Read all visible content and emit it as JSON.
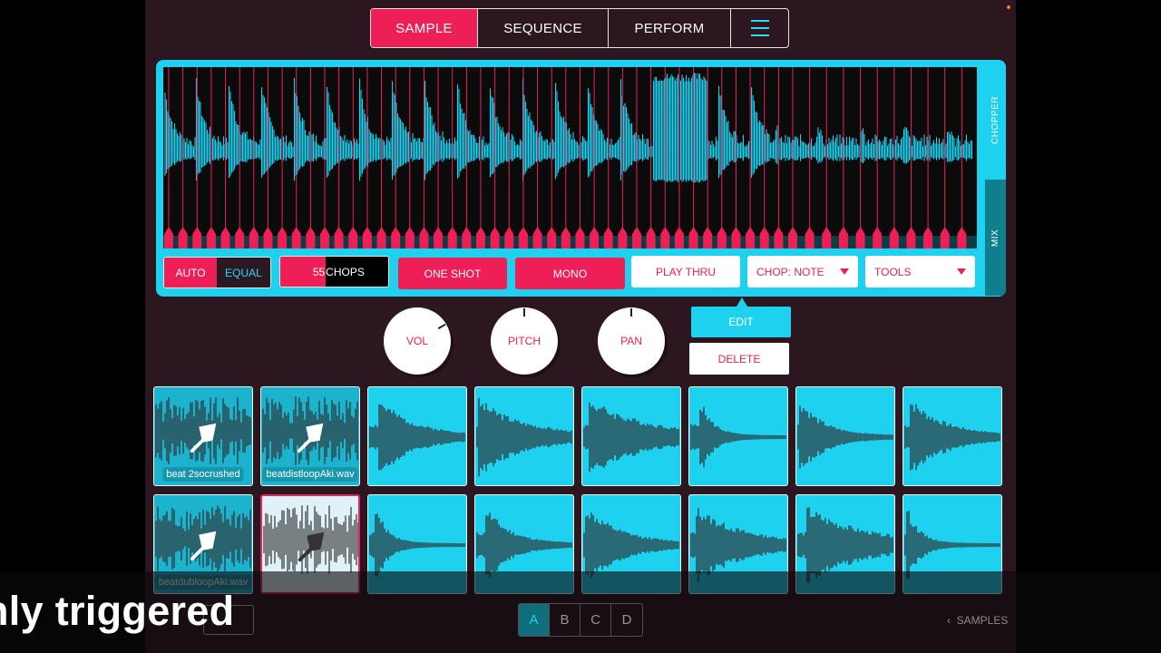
{
  "nav": {
    "tabs": [
      {
        "label": "SAMPLE",
        "active": true
      },
      {
        "label": "SEQUENCE",
        "active": false
      },
      {
        "label": "PERFORM",
        "active": false
      }
    ],
    "menu_icon": "hamburger-menu-icon"
  },
  "chopper": {
    "side_tabs": [
      "CHOPPER",
      "MIX"
    ],
    "mode": {
      "auto": "AUTO",
      "equal": "EQUAL",
      "active": "EQUAL"
    },
    "chops": {
      "count": "55",
      "label": "CHOPS"
    },
    "one_shot": "ONE SHOT",
    "mono": "MONO",
    "play_thru": "PLAY THRU",
    "chop_note": "CHOP: NOTE",
    "tools": "TOOLS"
  },
  "knobs": {
    "vol": {
      "label": "VOL",
      "level": 0.72
    },
    "pitch": {
      "label": "PITCH",
      "level": 0.5
    },
    "pan": {
      "label": "PAN",
      "level": 0.5
    }
  },
  "actions": {
    "edit": "EDIT",
    "delete": "DELETE"
  },
  "pads": [
    {
      "name": "beat 2socrushed",
      "chopped": true
    },
    {
      "name": "beatdistloopAki.wav",
      "chopped": true
    },
    {
      "name": "",
      "chopped": false
    },
    {
      "name": "",
      "chopped": false
    },
    {
      "name": "",
      "chopped": false
    },
    {
      "name": "",
      "chopped": false
    },
    {
      "name": "",
      "chopped": false
    },
    {
      "name": "",
      "chopped": false
    },
    {
      "name": "beatdubloopAki.wav",
      "chopped": true
    },
    {
      "name": "",
      "chopped": true,
      "selected": true
    },
    {
      "name": "",
      "chopped": false
    },
    {
      "name": "",
      "chopped": false
    },
    {
      "name": "",
      "chopped": false
    },
    {
      "name": "",
      "chopped": false
    },
    {
      "name": "",
      "chopped": false
    },
    {
      "name": "",
      "chopped": false
    }
  ],
  "banks": {
    "labels": [
      "A",
      "B",
      "C",
      "D"
    ],
    "active": "A"
  },
  "samples_link": "SAMPLES",
  "caption": "nly triggered",
  "colors": {
    "accent_pink": "#ee1f57",
    "accent_cyan": "#1ed1ef",
    "background": "#2c1721"
  }
}
